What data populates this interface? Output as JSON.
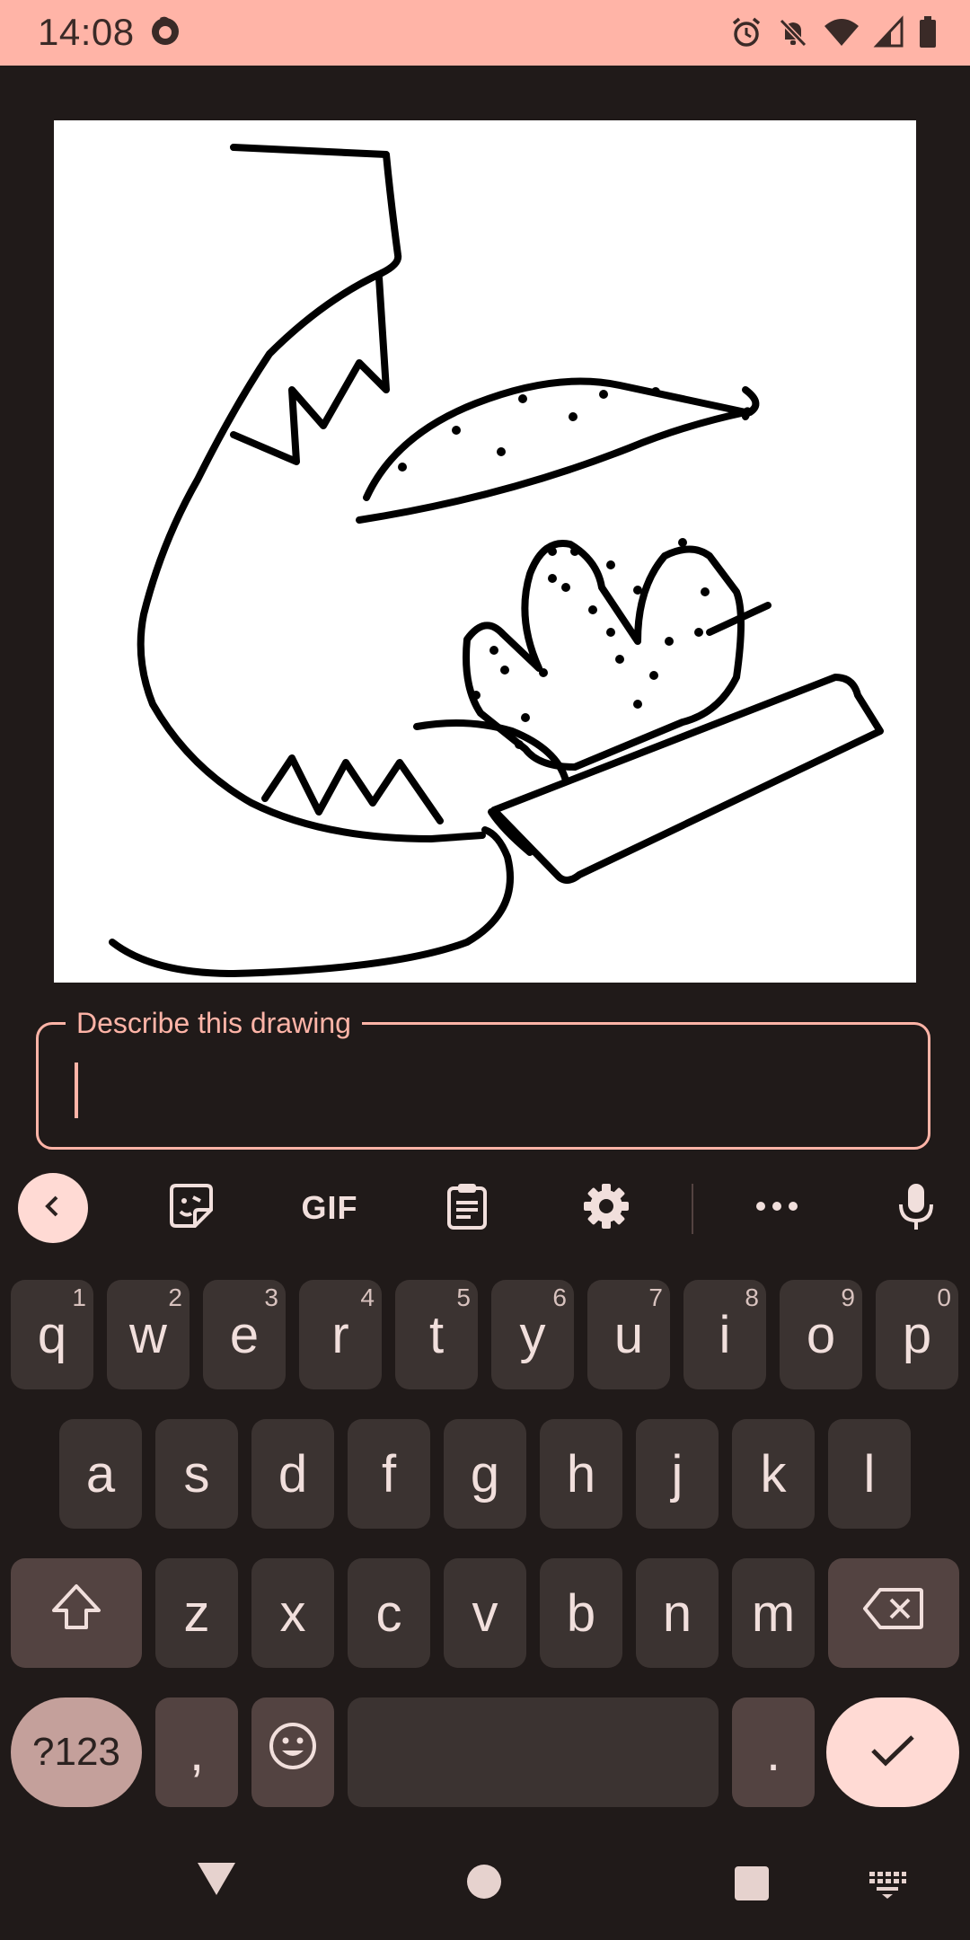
{
  "status_bar": {
    "time": "14:08",
    "icons": [
      "firefox-icon",
      "alarm-icon",
      "notifications-off-icon",
      "wifi-icon",
      "signal-icon",
      "battery-icon"
    ]
  },
  "drawing": {
    "description": "user drawing canvas"
  },
  "text_field": {
    "label": "Describe this drawing",
    "value": ""
  },
  "keyboard_toolbar": {
    "gif_label": "GIF",
    "items": [
      "back-icon",
      "sticker-icon",
      "gif",
      "clipboard-icon",
      "settings-icon",
      "more-icon",
      "mic-icon"
    ]
  },
  "keyboard": {
    "row1": [
      {
        "key": "q",
        "hint": "1"
      },
      {
        "key": "w",
        "hint": "2"
      },
      {
        "key": "e",
        "hint": "3"
      },
      {
        "key": "r",
        "hint": "4"
      },
      {
        "key": "t",
        "hint": "5"
      },
      {
        "key": "y",
        "hint": "6"
      },
      {
        "key": "u",
        "hint": "7"
      },
      {
        "key": "i",
        "hint": "8"
      },
      {
        "key": "o",
        "hint": "9"
      },
      {
        "key": "p",
        "hint": "0"
      }
    ],
    "row2": [
      "a",
      "s",
      "d",
      "f",
      "g",
      "h",
      "j",
      "k",
      "l"
    ],
    "row3": [
      "z",
      "x",
      "c",
      "v",
      "b",
      "n",
      "m"
    ],
    "symbols_label": "?123",
    "comma_label": ",",
    "period_label": "."
  },
  "colors": {
    "accent": "#ffb4a7",
    "background": "#201a19",
    "key": "#3b3331",
    "key_special": "#534341"
  }
}
